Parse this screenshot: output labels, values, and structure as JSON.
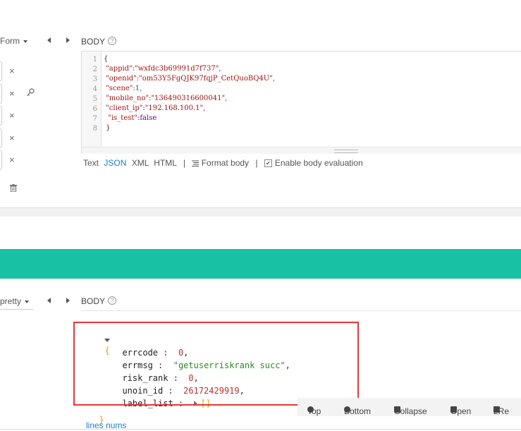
{
  "request": {
    "body_type_select": "Form",
    "body_label": "BODY",
    "help_icon": "?",
    "remove_icon": "×",
    "key_icon": "key-icon",
    "trash_icon": "trash-icon",
    "editor_line_numbers": [
      "1",
      "2",
      "3",
      "4",
      "5",
      "6",
      "7",
      "8"
    ],
    "editor_lines": [
      {
        "a": "{",
        "b": "",
        "c": ""
      },
      {
        "a": " ",
        "b": "\"appid\"",
        "c": ":\"wxfdc3b69991d7f737\","
      },
      {
        "a": " ",
        "b": "\"openid\"",
        "c": ":\"om53Y5FgQJK97fqjP_CetQuoBQ4U\","
      },
      {
        "a": " ",
        "b": "\"scene\"",
        "c": ":1,"
      },
      {
        "a": " ",
        "b": "\"mobile_no\"",
        "c": ":\"136490316600041\","
      },
      {
        "a": " ",
        "b": "\"client_ip\"",
        "c": ":\"192.168.100.1\","
      },
      {
        "a": "  ",
        "b": "\"is_test\"",
        "c": ":false"
      },
      {
        "a": " }",
        "b": "",
        "c": ""
      }
    ],
    "format_options": [
      "Text",
      "JSON",
      "XML",
      "HTML"
    ],
    "separator": "|",
    "format_body_label": "Format body",
    "enable_eval_label": "Enable body evaluation",
    "enable_eval_checked": "✔"
  },
  "response": {
    "view_select": "pretty",
    "body_label": "BODY",
    "help_icon": "?",
    "open_brace": "{",
    "close_brace": "}",
    "fields": [
      {
        "key": "errcode",
        "sep": " :  ",
        "value": "0",
        "tail": ",",
        "type": "num"
      },
      {
        "key": "errmsg",
        "sep": " :  ",
        "value": "\"getuserriskrank succ\"",
        "tail": ",",
        "type": "str"
      },
      {
        "key": "risk_rank",
        "sep": " :  ",
        "value": "0",
        "tail": ",",
        "type": "num"
      },
      {
        "key": "unoin_id",
        "sep": " :  ",
        "value": "26172429919",
        "tail": ",",
        "type": "num"
      },
      {
        "key": "label_list",
        "sep": " :  ",
        "value": "[]",
        "tail": "",
        "type": "arr"
      }
    ],
    "toolbar": {
      "top": "Top",
      "bottom": "Bottom",
      "collapse": "Collapse",
      "open": "Open",
      "raw": "2Re"
    },
    "lines_nums_link": "lines nums"
  },
  "colors": {
    "accent_band": "#18c0a4",
    "highlight_box": "#e33333",
    "link": "#1a7fd0"
  }
}
